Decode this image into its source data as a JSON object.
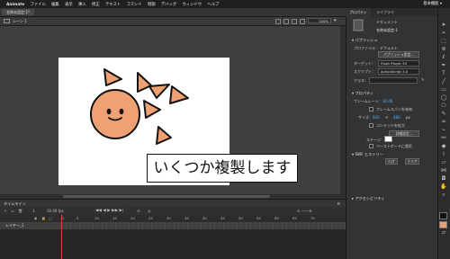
{
  "menubar": {
    "app_name": "Animate",
    "items": [
      "ファイル",
      "編集",
      "表示",
      "挿入",
      "修正",
      "テキスト",
      "コマンド",
      "制御",
      "デバッグ",
      "ウィンドウ",
      "ヘルプ"
    ],
    "right": "基本機能 ▾"
  },
  "document": {
    "tab_title": "名称未設定-1*",
    "scene": "シーン 1",
    "zoom": "100%"
  },
  "stage": {
    "text_content": "いくつか複製します",
    "stage_color": "#ffffff",
    "shape_fill": "#f0a173",
    "shape_stroke": "#111111"
  },
  "timeline": {
    "title": "タイムライン",
    "fps": "30.00 fps",
    "current_frame": "1",
    "ruler_numbers": [
      "1",
      "5",
      "10",
      "15",
      "20",
      "25",
      "30",
      "35",
      "40",
      "45",
      "50",
      "55",
      "60",
      "65",
      "70"
    ],
    "layer_name": "レイヤー_1"
  },
  "properties": {
    "tabs": [
      "プロパティ",
      "ライブラリ"
    ],
    "type_label": "ドキュメント",
    "document_name": "名称未設定-1",
    "publish_section": "パブリッシュ",
    "profile_label": "プロファイル：",
    "profile_value": "デフォルト",
    "publish_settings_button": "パブリッシュ設定...",
    "target_label": "ターゲット：",
    "target_value": "Flash Player 30",
    "script_label": "スクリプト：",
    "script_value": "ActionScript 3.0",
    "class_label": "クラス：",
    "properties_section": "プロパティ",
    "fps_label": "フレームレート：",
    "fps_value": "30.00",
    "frame_span_label": "フレームスパンを有効",
    "size_label": "サイズ：",
    "width_value": "640",
    "height_value": "480",
    "unit": "px",
    "scale_content_label": "コンテンツを拡大",
    "advanced_button": "詳細設定...",
    "stage_label": "ステージ：",
    "stage_color": "#ffffff",
    "pasteboard_label": "ペーストボードに適用",
    "swf_section": "SWF ヒストリー",
    "log_button": "ログ",
    "clear_button": "クリア",
    "accessibility_section": "アクセシビリティ"
  },
  "colors": {
    "accent_blue": "#5fb0ff",
    "playhead_red": "#e0433a",
    "swatch_stroke": "#111111",
    "swatch_fill": "#f0a173"
  },
  "tools": [
    "selection-icon",
    "subselection-icon",
    "free-transform-icon",
    "3d-rotation-icon",
    "lasso-icon",
    "pen-icon",
    "text-icon",
    "line-icon",
    "rectangle-icon",
    "oval-icon",
    "polystar-icon",
    "pencil-icon",
    "brush-icon",
    "paint-brush-icon",
    "bone-icon",
    "paint-bucket-icon",
    "eyedropper-icon",
    "eraser-icon",
    "width-icon",
    "camera-icon",
    "hand-icon",
    "zoom-icon"
  ]
}
